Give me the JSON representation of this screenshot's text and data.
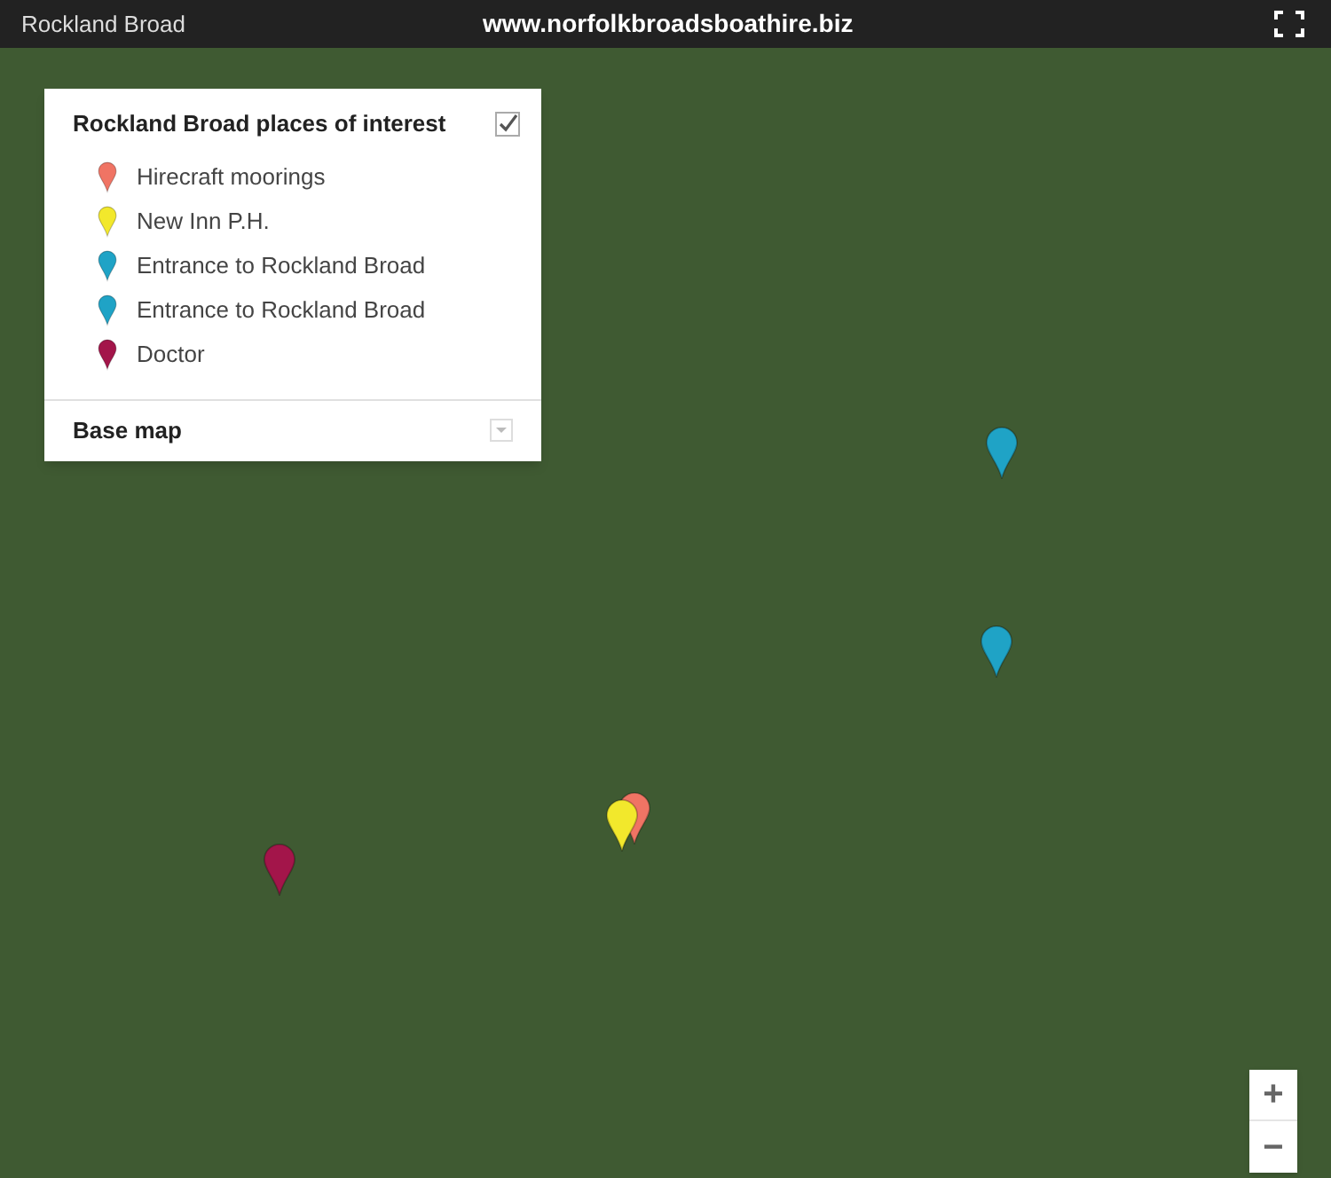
{
  "header": {
    "title": "Rockland Broad",
    "url": "www.norfolkbroadsboathire.biz"
  },
  "legend": {
    "title": "Rockland Broad places of interest",
    "checked": true,
    "items": [
      {
        "label": "Hirecraft moorings",
        "color": "#f07464"
      },
      {
        "label": "New Inn P.H.",
        "color": "#f2e82c"
      },
      {
        "label": "Entrance to Rockland Broad",
        "color": "#1fa3c6"
      },
      {
        "label": "Entrance to Rockland Broad",
        "color": "#1fa3c6"
      },
      {
        "label": "Doctor",
        "color": "#a3154a"
      }
    ],
    "base_map": {
      "label": "Base map",
      "expanded": false
    }
  },
  "map_pins": [
    {
      "color": "#f07464"
    },
    {
      "color": "#f2e82c"
    },
    {
      "color": "#1fa3c6"
    },
    {
      "color": "#1fa3c6"
    },
    {
      "color": "#a3154a"
    }
  ],
  "zoom": {
    "in": "+",
    "out": "−"
  }
}
